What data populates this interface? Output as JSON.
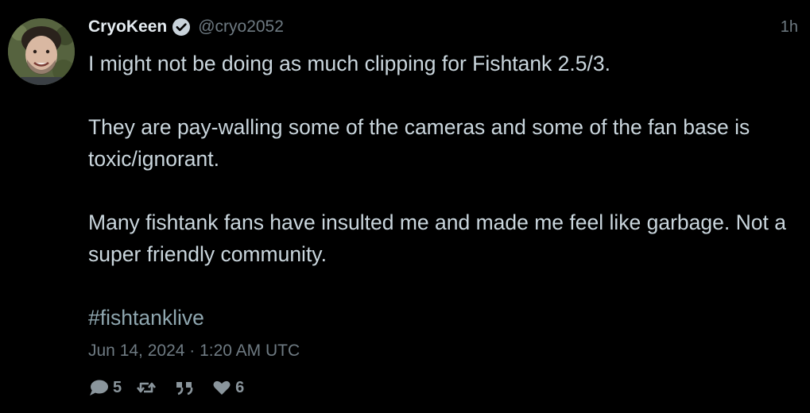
{
  "tweet": {
    "author": {
      "display_name": "CryoKeen",
      "handle": "@cryo2052",
      "verified": true
    },
    "time_ago": "1h",
    "paragraphs": [
      "I might not be doing as much clipping for Fishtank 2.5/3.",
      "They are pay-walling some of the cameras and some of the fan base is toxic/ignorant.",
      "Many fishtank fans have insulted me and made me feel like garbage. Not a super friendly community."
    ],
    "hashtag": "#fishtanklive",
    "date": "Jun 14, 2024 · 1:20 AM UTC",
    "stats": {
      "replies": "5",
      "retweets": "",
      "quotes": "",
      "likes": "6"
    }
  },
  "colors": {
    "background": "#000000",
    "text": "#cad6dd",
    "muted": "#6e7a82",
    "hashtag": "#8fa7b0"
  },
  "icons": [
    "verified-badge-icon",
    "reply-icon",
    "retweet-icon",
    "quote-icon",
    "like-icon"
  ]
}
